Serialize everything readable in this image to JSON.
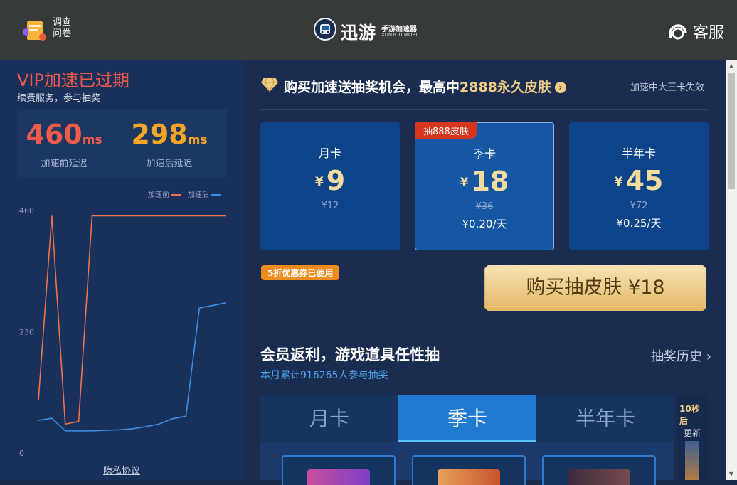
{
  "header": {
    "survey_label_1": "调查",
    "survey_label_2": "问卷",
    "logo_text": "迅游",
    "logo_sub1": "手游加速器",
    "logo_sub2": "XUNYOU.MOBI",
    "service_label": "客服"
  },
  "left_panel": {
    "vip_title": "VIP加速已过期",
    "vip_subtitle": "续费服务，参与抽奖",
    "before": {
      "value": "460",
      "unit": "ms",
      "caption": "加速前延迟"
    },
    "after": {
      "value": "298",
      "unit": "ms",
      "caption": "加速后延迟"
    },
    "privacy_link": "隐私协议"
  },
  "chart_data": {
    "type": "line",
    "ylim": [
      0,
      460
    ],
    "yticks": [
      "460",
      "230",
      "0"
    ],
    "legend_position": "top-right",
    "x": [
      0,
      1,
      2,
      3,
      4,
      5,
      6,
      7,
      8,
      9,
      10,
      11,
      12,
      13,
      14
    ],
    "series": [
      {
        "name": "加速前",
        "color": "#e8734d",
        "values": [
          100,
          450,
          55,
          60,
          450,
          450,
          450,
          450,
          450,
          450,
          450,
          450,
          450,
          450,
          450
        ]
      },
      {
        "name": "加速后",
        "color": "#3a8de8",
        "values": [
          62,
          66,
          42,
          42,
          42,
          43,
          44,
          46,
          50,
          55,
          65,
          70,
          275,
          280,
          285
        ]
      }
    ]
  },
  "promo": {
    "text": "购买加速送抽奖机会，最高中",
    "highlight": "2888永久皮肤",
    "note": "加速中大王卡失效"
  },
  "plans": [
    {
      "name": "月卡",
      "currency": "¥",
      "price": "9",
      "original": "¥12",
      "per_day": ""
    },
    {
      "name": "季卡",
      "currency": "¥",
      "price": "18",
      "original": "¥36",
      "per_day": "¥0.20/天",
      "badge": "抽888皮肤"
    },
    {
      "name": "半年卡",
      "currency": "¥",
      "price": "45",
      "original": "¥72",
      "per_day": "¥0.25/天"
    }
  ],
  "coupon_label": "5折优惠券已使用",
  "buy_button_label": "购买抽皮肤 ¥18",
  "rebate": {
    "title": "会员返利，游戏道具任性抽",
    "subtitle": "本月累计916265人参与抽奖",
    "history_label": "抽奖历史",
    "tabs": [
      "月卡",
      "季卡",
      "半年卡"
    ],
    "active_tab": "季卡",
    "side_text_1": "10秒后",
    "side_text_2": "更新"
  },
  "colors": {
    "accent_gold": "#f3da9e",
    "vip_red": "#ef5a4a",
    "after_orange": "#f6a423"
  }
}
